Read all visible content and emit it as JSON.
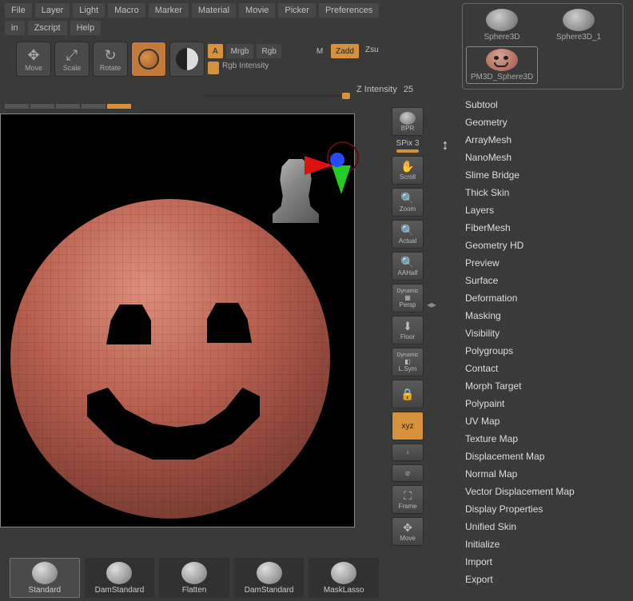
{
  "menu": {
    "row1": [
      "File",
      "Layer",
      "Light",
      "Macro",
      "Marker",
      "Material",
      "Movie",
      "Picker",
      "Preferences"
    ],
    "row2": [
      "in",
      "Zscript",
      "Help"
    ]
  },
  "tools": {
    "move": "Move",
    "scale": "Scale",
    "rotate": "Rotate"
  },
  "paint": {
    "a": "A",
    "mrgb": "Mrgb",
    "rgb": "Rgb",
    "m": "M",
    "zadd": "Zadd",
    "zsu": "Zsu",
    "rgb_intensity": "Rgb Intensity",
    "z_intensity": "Z Intensity",
    "z_val": "25"
  },
  "side": {
    "bpr": "BPR",
    "spix_label": "SPix",
    "spix_val": "3",
    "scroll": "Scroll",
    "zoom": "Zoom",
    "actual": "Actual",
    "aahalf": "AAHalf",
    "dynamic": "Dynamic",
    "persp": "Persp",
    "floor": "Floor",
    "lsym": "L.Sym",
    "xyz": "xyz",
    "frame": "Frame",
    "move": "Move"
  },
  "subtools": {
    "items": [
      {
        "label": "Sphere3D"
      },
      {
        "label": "Sphere3D_1"
      },
      {
        "label": "PM3D_Sphere3D"
      }
    ]
  },
  "accordion": [
    "Subtool",
    "Geometry",
    "ArrayMesh",
    "NanoMesh",
    "Slime Bridge",
    "Thick Skin",
    "Layers",
    "FiberMesh",
    "Geometry HD",
    "Preview",
    "Surface",
    "Deformation",
    "Masking",
    "Visibility",
    "Polygroups",
    "Contact",
    "Morph Target",
    "Polypaint",
    "UV Map",
    "Texture Map",
    "Displacement Map",
    "Normal Map",
    "Vector Displacement Map",
    "Display Properties",
    "Unified Skin",
    "Initialize",
    "Import",
    "Export"
  ],
  "brushes": [
    "Standard",
    "DamStandard",
    "Flatten",
    "DamStandard",
    "MaskLasso"
  ]
}
